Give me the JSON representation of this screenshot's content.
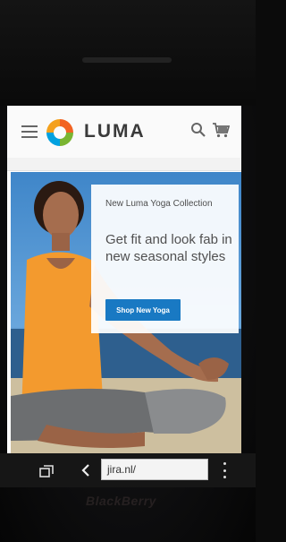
{
  "header": {
    "logo_text": "LUMA",
    "colors": {
      "accent": "#1979c3",
      "logo_orange": "#f26322"
    }
  },
  "promo": {
    "subtitle": "New Luma Yoga Collection",
    "title": "Get fit and look fab in new seasonal styles",
    "button_label": "Shop New Yoga"
  },
  "browser": {
    "url": "jira.nl/"
  },
  "device": {
    "brand": "BlackBerry"
  }
}
